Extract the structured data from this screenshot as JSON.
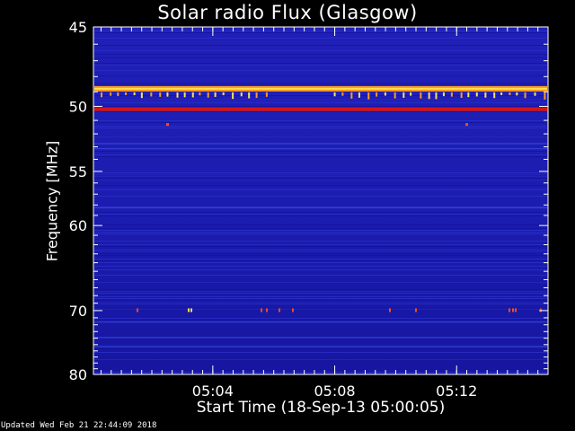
{
  "chart_data": {
    "type": "heatmap",
    "title": "Solar radio Flux (Glasgow)",
    "ylabel": "Frequency [MHz]",
    "xlabel": "Start Time (18-Sep-13 05:00:05)",
    "y_ticks": [
      45,
      50,
      55,
      60,
      70,
      80
    ],
    "y_range": [
      45,
      80
    ],
    "x_ticks": [
      "05:04",
      "05:08",
      "05:12"
    ],
    "x_range": [
      "05:00:05",
      "05:15:00"
    ],
    "grid": false,
    "colors": {
      "background": "#1a1aa8",
      "band_orange": "#ff9a1e",
      "band_yellow": "#ffe050",
      "band_red": "#d81414",
      "speckle": "#ff4a1e"
    },
    "features": [
      {
        "name": "interference band",
        "frequency_mhz": 48.8,
        "intensity": "high"
      },
      {
        "name": "interference band",
        "frequency_mhz": 50.2,
        "intensity": "medium"
      }
    ]
  },
  "footer": "Updated Wed Feb 21 22:44:09 2018"
}
